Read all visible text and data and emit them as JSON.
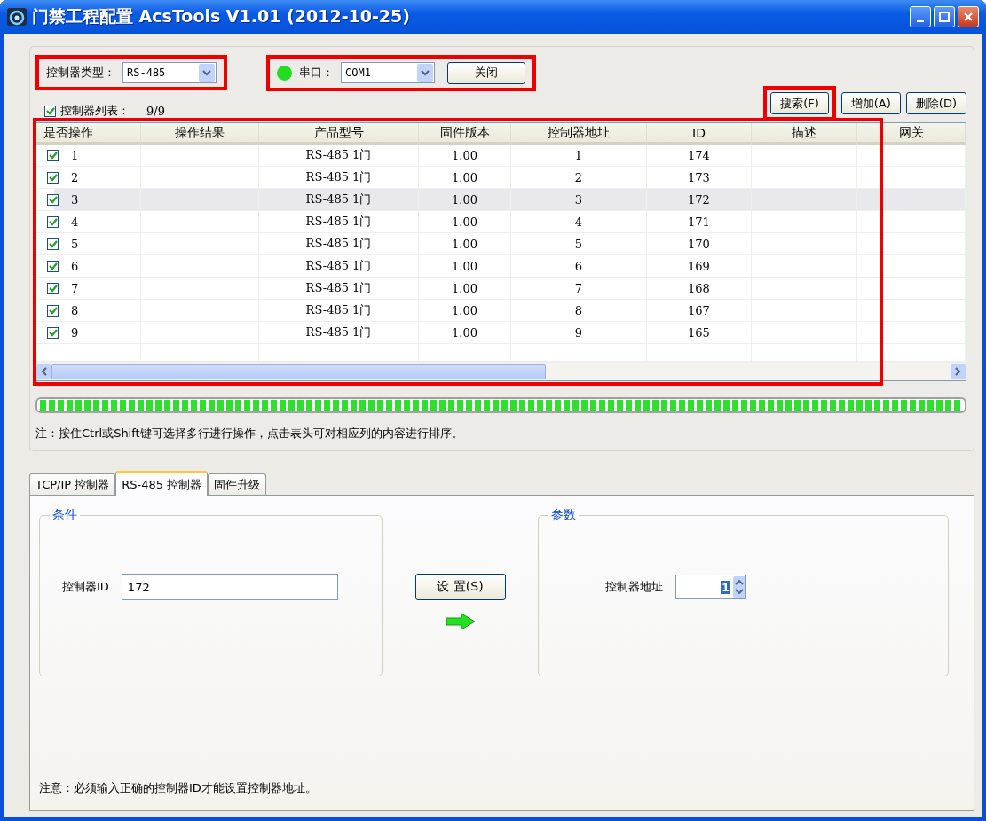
{
  "window": {
    "title": "门禁工程配置 AcsTools V1.01 (2012-10-25)"
  },
  "controller_type": {
    "label": "控制器类型：",
    "value": "RS-485",
    "highlighted": true
  },
  "serial_port": {
    "connected": true,
    "label": "串口：",
    "value": "COM1",
    "button": "关闭",
    "highlighted": true
  },
  "controller_list": {
    "checked": true,
    "label": "控制器列表：",
    "count": "9/9"
  },
  "actions": [
    {
      "label": "搜索(F)",
      "highlighted": true
    },
    {
      "label": "增加(A)",
      "highlighted": false
    },
    {
      "label": "删除(D)",
      "highlighted": false
    }
  ],
  "table": {
    "highlighted": true,
    "columns": [
      "是否操作",
      "操作结果",
      "产品型号",
      "固件版本",
      "控制器地址",
      "ID",
      "描述",
      "网关"
    ],
    "rows": [
      {
        "checked": true,
        "selected": false,
        "cells": [
          "1",
          "",
          "RS-485 1门",
          "1.00",
          "1",
          "174",
          "",
          ""
        ]
      },
      {
        "checked": true,
        "selected": false,
        "cells": [
          "2",
          "",
          "RS-485 1门",
          "1.00",
          "2",
          "173",
          "",
          ""
        ]
      },
      {
        "checked": true,
        "selected": true,
        "cells": [
          "3",
          "",
          "RS-485 1门",
          "1.00",
          "3",
          "172",
          "",
          ""
        ]
      },
      {
        "checked": true,
        "selected": false,
        "cells": [
          "4",
          "",
          "RS-485 1门",
          "1.00",
          "4",
          "171",
          "",
          ""
        ]
      },
      {
        "checked": true,
        "selected": false,
        "cells": [
          "5",
          "",
          "RS-485 1门",
          "1.00",
          "5",
          "170",
          "",
          ""
        ]
      },
      {
        "checked": true,
        "selected": false,
        "cells": [
          "6",
          "",
          "RS-485 1门",
          "1.00",
          "6",
          "169",
          "",
          ""
        ]
      },
      {
        "checked": true,
        "selected": false,
        "cells": [
          "7",
          "",
          "RS-485 1门",
          "1.00",
          "7",
          "168",
          "",
          ""
        ]
      },
      {
        "checked": true,
        "selected": false,
        "cells": [
          "8",
          "",
          "RS-485 1门",
          "1.00",
          "8",
          "167",
          "",
          ""
        ]
      },
      {
        "checked": true,
        "selected": false,
        "cells": [
          "9",
          "",
          "RS-485 1门",
          "1.00",
          "9",
          "165",
          "",
          ""
        ]
      }
    ]
  },
  "progress": {
    "level": 1
  },
  "note": "注：按住Ctrl或Shift键可选择多行进行操作，点击表头可对相应列的内容进行排序。",
  "tabs": [
    {
      "label": "TCP/IP 控制器",
      "selected": false
    },
    {
      "label": "RS-485 控制器",
      "selected": true
    },
    {
      "label": "固件升级",
      "selected": false
    }
  ],
  "condition": {
    "title": "条件",
    "label": "控制器ID",
    "value": "172"
  },
  "set_button": "设 置(S)",
  "parameters": {
    "title": "参数",
    "label": "控制器地址",
    "value": "1"
  },
  "footer_note": "注意：必须输入正确的控制器ID才能设置控制器地址。"
}
